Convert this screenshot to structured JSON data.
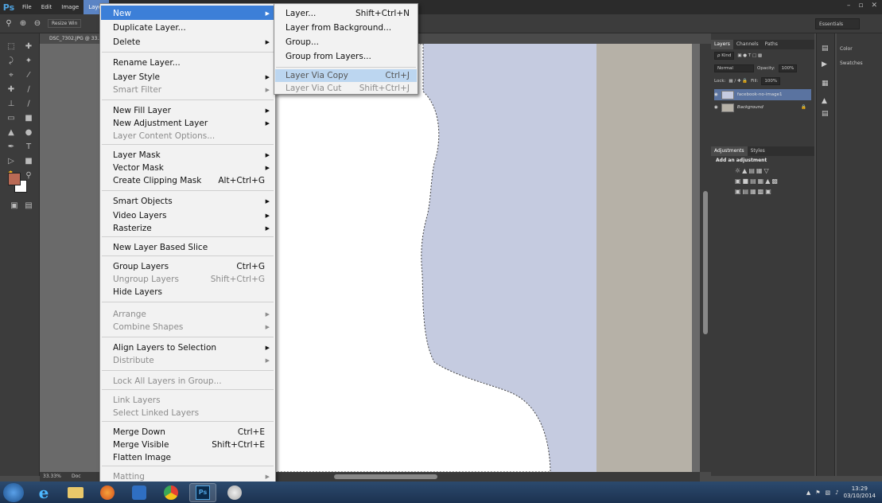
{
  "app": {
    "logo": "Ps",
    "menus": [
      "File",
      "Edit",
      "Image",
      "Layer"
    ],
    "active_menu": "Layer",
    "window_controls": [
      "–",
      "▫",
      "✕"
    ]
  },
  "options_bar": {
    "resize_label": "Resize Win",
    "workspace": "Essentials"
  },
  "document": {
    "tab_title": "DSC_7302.JPG @ 33.3",
    "zoom": "33.33%",
    "doc_info": "Doc"
  },
  "layer_menu": {
    "items": [
      {
        "label": "New",
        "shortcut": "",
        "submenu": true,
        "disabled": false
      },
      {
        "label": "Duplicate Layer...",
        "shortcut": "",
        "submenu": false,
        "disabled": false
      },
      {
        "label": "Delete",
        "shortcut": "",
        "submenu": true,
        "disabled": false
      },
      {
        "label": "Rename Layer...",
        "shortcut": "",
        "submenu": false,
        "disabled": false
      },
      {
        "label": "Layer Style",
        "shortcut": "",
        "submenu": true,
        "disabled": false
      },
      {
        "label": "Smart Filter",
        "shortcut": "",
        "submenu": true,
        "disabled": true
      },
      {
        "label": "New Fill Layer",
        "shortcut": "",
        "submenu": true,
        "disabled": false
      },
      {
        "label": "New Adjustment Layer",
        "shortcut": "",
        "submenu": true,
        "disabled": false
      },
      {
        "label": "Layer Content Options...",
        "shortcut": "",
        "submenu": false,
        "disabled": true
      },
      {
        "label": "Layer Mask",
        "shortcut": "",
        "submenu": true,
        "disabled": false
      },
      {
        "label": "Vector Mask",
        "shortcut": "",
        "submenu": true,
        "disabled": false
      },
      {
        "label": "Create Clipping Mask",
        "shortcut": "Alt+Ctrl+G",
        "submenu": false,
        "disabled": false
      },
      {
        "label": "Smart Objects",
        "shortcut": "",
        "submenu": true,
        "disabled": false
      },
      {
        "label": "Video Layers",
        "shortcut": "",
        "submenu": true,
        "disabled": false
      },
      {
        "label": "Rasterize",
        "shortcut": "",
        "submenu": true,
        "disabled": false
      },
      {
        "label": "New Layer Based Slice",
        "shortcut": "",
        "submenu": false,
        "disabled": false
      },
      {
        "label": "Group Layers",
        "shortcut": "Ctrl+G",
        "submenu": false,
        "disabled": false
      },
      {
        "label": "Ungroup Layers",
        "shortcut": "Shift+Ctrl+G",
        "submenu": false,
        "disabled": true
      },
      {
        "label": "Hide Layers",
        "shortcut": "",
        "submenu": false,
        "disabled": false
      },
      {
        "label": "Arrange",
        "shortcut": "",
        "submenu": true,
        "disabled": true
      },
      {
        "label": "Combine Shapes",
        "shortcut": "",
        "submenu": true,
        "disabled": true
      },
      {
        "label": "Align Layers to Selection",
        "shortcut": "",
        "submenu": true,
        "disabled": false
      },
      {
        "label": "Distribute",
        "shortcut": "",
        "submenu": true,
        "disabled": true
      },
      {
        "label": "Lock All Layers in Group...",
        "shortcut": "",
        "submenu": false,
        "disabled": true
      },
      {
        "label": "Link Layers",
        "shortcut": "",
        "submenu": false,
        "disabled": true
      },
      {
        "label": "Select Linked Layers",
        "shortcut": "",
        "submenu": false,
        "disabled": true
      },
      {
        "label": "Merge Down",
        "shortcut": "Ctrl+E",
        "submenu": false,
        "disabled": false
      },
      {
        "label": "Merge Visible",
        "shortcut": "Shift+Ctrl+E",
        "submenu": false,
        "disabled": false
      },
      {
        "label": "Flatten Image",
        "shortcut": "",
        "submenu": false,
        "disabled": false
      },
      {
        "label": "Matting",
        "shortcut": "",
        "submenu": true,
        "disabled": true
      }
    ]
  },
  "new_submenu": {
    "items": [
      {
        "label": "Layer...",
        "shortcut": "Shift+Ctrl+N"
      },
      {
        "label": "Layer from Background..."
      },
      {
        "label": "Group..."
      },
      {
        "label": "Group from Layers..."
      },
      {
        "label": "Layer Via Copy",
        "shortcut": "Ctrl+J"
      },
      {
        "label": "Layer Via Cut",
        "shortcut": "Shift+Ctrl+J"
      }
    ]
  },
  "layers_panel": {
    "tabs": [
      "Layers",
      "Channels",
      "Paths"
    ],
    "kind_label": "ρ Kind",
    "blend_mode": "Normal",
    "opacity_label": "Opacity:",
    "opacity_value": "100%",
    "lock_label": "Lock:",
    "fill_label": "Fill:",
    "fill_value": "100%",
    "layers": [
      {
        "name": "facebook-no-image1",
        "selected": true
      },
      {
        "name": "Background",
        "selected": false
      }
    ]
  },
  "adjustments_panel": {
    "tabs": [
      "Adjustments",
      "Styles"
    ],
    "title": "Add an adjustment"
  },
  "side_panel": {
    "items": [
      "Color",
      "Swatches"
    ]
  },
  "taskbar": {
    "time": "13:29",
    "date": "03/10/2014"
  },
  "colors": {
    "accent": "#3c7fd8",
    "foreground_swatch": "#b96a55",
    "photo_background": "#c5cbe0"
  }
}
